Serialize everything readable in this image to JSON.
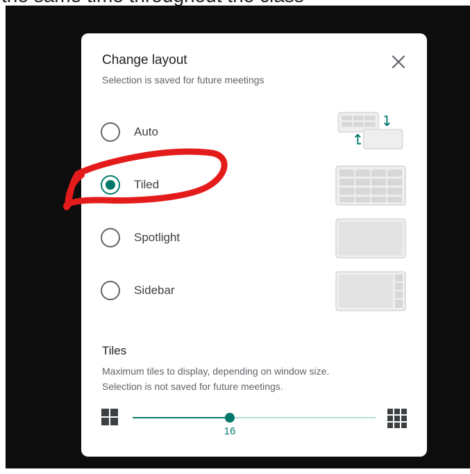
{
  "background_text": "the same time throughout the class",
  "dialog": {
    "title": "Change layout",
    "subtitle": "Selection is saved for future meetings",
    "close_icon": "close-icon"
  },
  "options": [
    {
      "label": "Auto",
      "selected": false,
      "icon": "auto-layout-icon"
    },
    {
      "label": "Tiled",
      "selected": true,
      "icon": "tiled-layout-icon"
    },
    {
      "label": "Spotlight",
      "selected": false,
      "icon": "spotlight-layout-icon"
    },
    {
      "label": "Sidebar",
      "selected": false,
      "icon": "sidebar-layout-icon"
    }
  ],
  "tiles": {
    "title": "Tiles",
    "desc_line1": "Maximum tiles to display, depending on window size.",
    "desc_line2": "Selection is not saved for future meetings.",
    "slider_value": "16",
    "slider_fraction": 0.4,
    "min_icon": "grid-small-icon",
    "max_icon": "grid-large-icon"
  },
  "colors": {
    "accent": "#00796b",
    "annotation": "#e41b1b"
  }
}
